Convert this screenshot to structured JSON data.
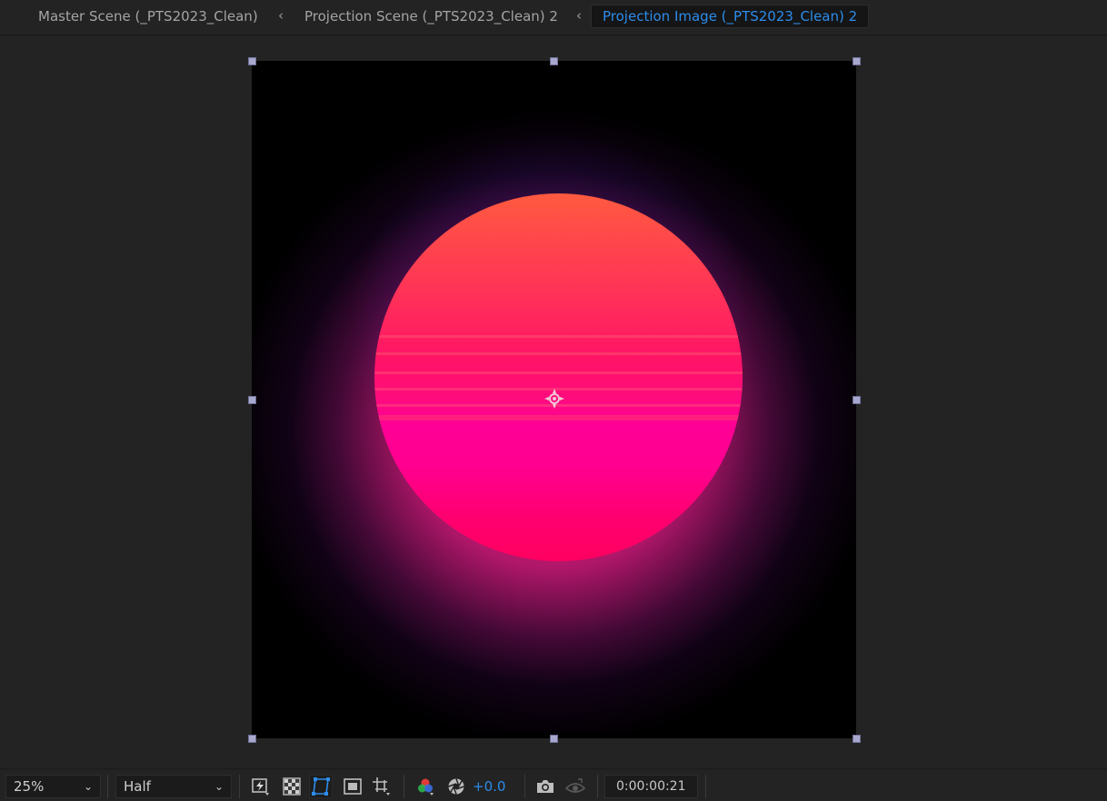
{
  "breadcrumbs": [
    {
      "label": "Master Scene (_PTS2023_Clean)"
    },
    {
      "label": "Projection Scene (_PTS2023_Clean) 2"
    },
    {
      "label": "Projection Image (_PTS2023_Clean) 2",
      "active": true
    }
  ],
  "separator_glyph": "‹",
  "toolbar": {
    "zoom_value": "25%",
    "resolution_value": "Half",
    "dropdown_chevron": "⌄",
    "exposure_value": "+0.0",
    "timecode": "0:00:00:21"
  },
  "icons": [
    "fast-previews-icon",
    "transparency-grid-icon",
    "mask-path-visibility-icon",
    "region-of-interest-icon",
    "grid-guides-icon",
    "color-channels-icon",
    "reset-exposure-icon",
    "snapshot-camera-icon",
    "show-snapshot-icon",
    "anchor-point-icon"
  ],
  "colors": {
    "accent": "#2d8ceb",
    "background": "#232323",
    "handle": "#a8a8cf",
    "sun_top": "#ff5a3f",
    "sun_bottom": "#ff0096"
  }
}
